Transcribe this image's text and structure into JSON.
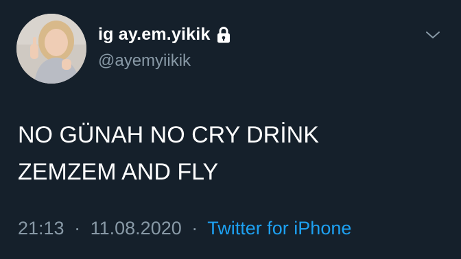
{
  "tweet": {
    "display_name": "ig ay.em.yikik",
    "handle": "@ayemyiikik",
    "text_line1": "NO GÜNAH NO CRY DRİNK",
    "text_line2": "ZEMZEM AND FLY",
    "time": "21:13",
    "date": "11.08.2020",
    "separator": "·",
    "source": "Twitter for iPhone"
  },
  "icons": {
    "lock": "lock-icon",
    "more": "chevron-down-icon"
  },
  "colors": {
    "background": "#15202b",
    "text": "#ffffff",
    "secondary_text": "#8899a6",
    "link": "#1da1f2"
  }
}
